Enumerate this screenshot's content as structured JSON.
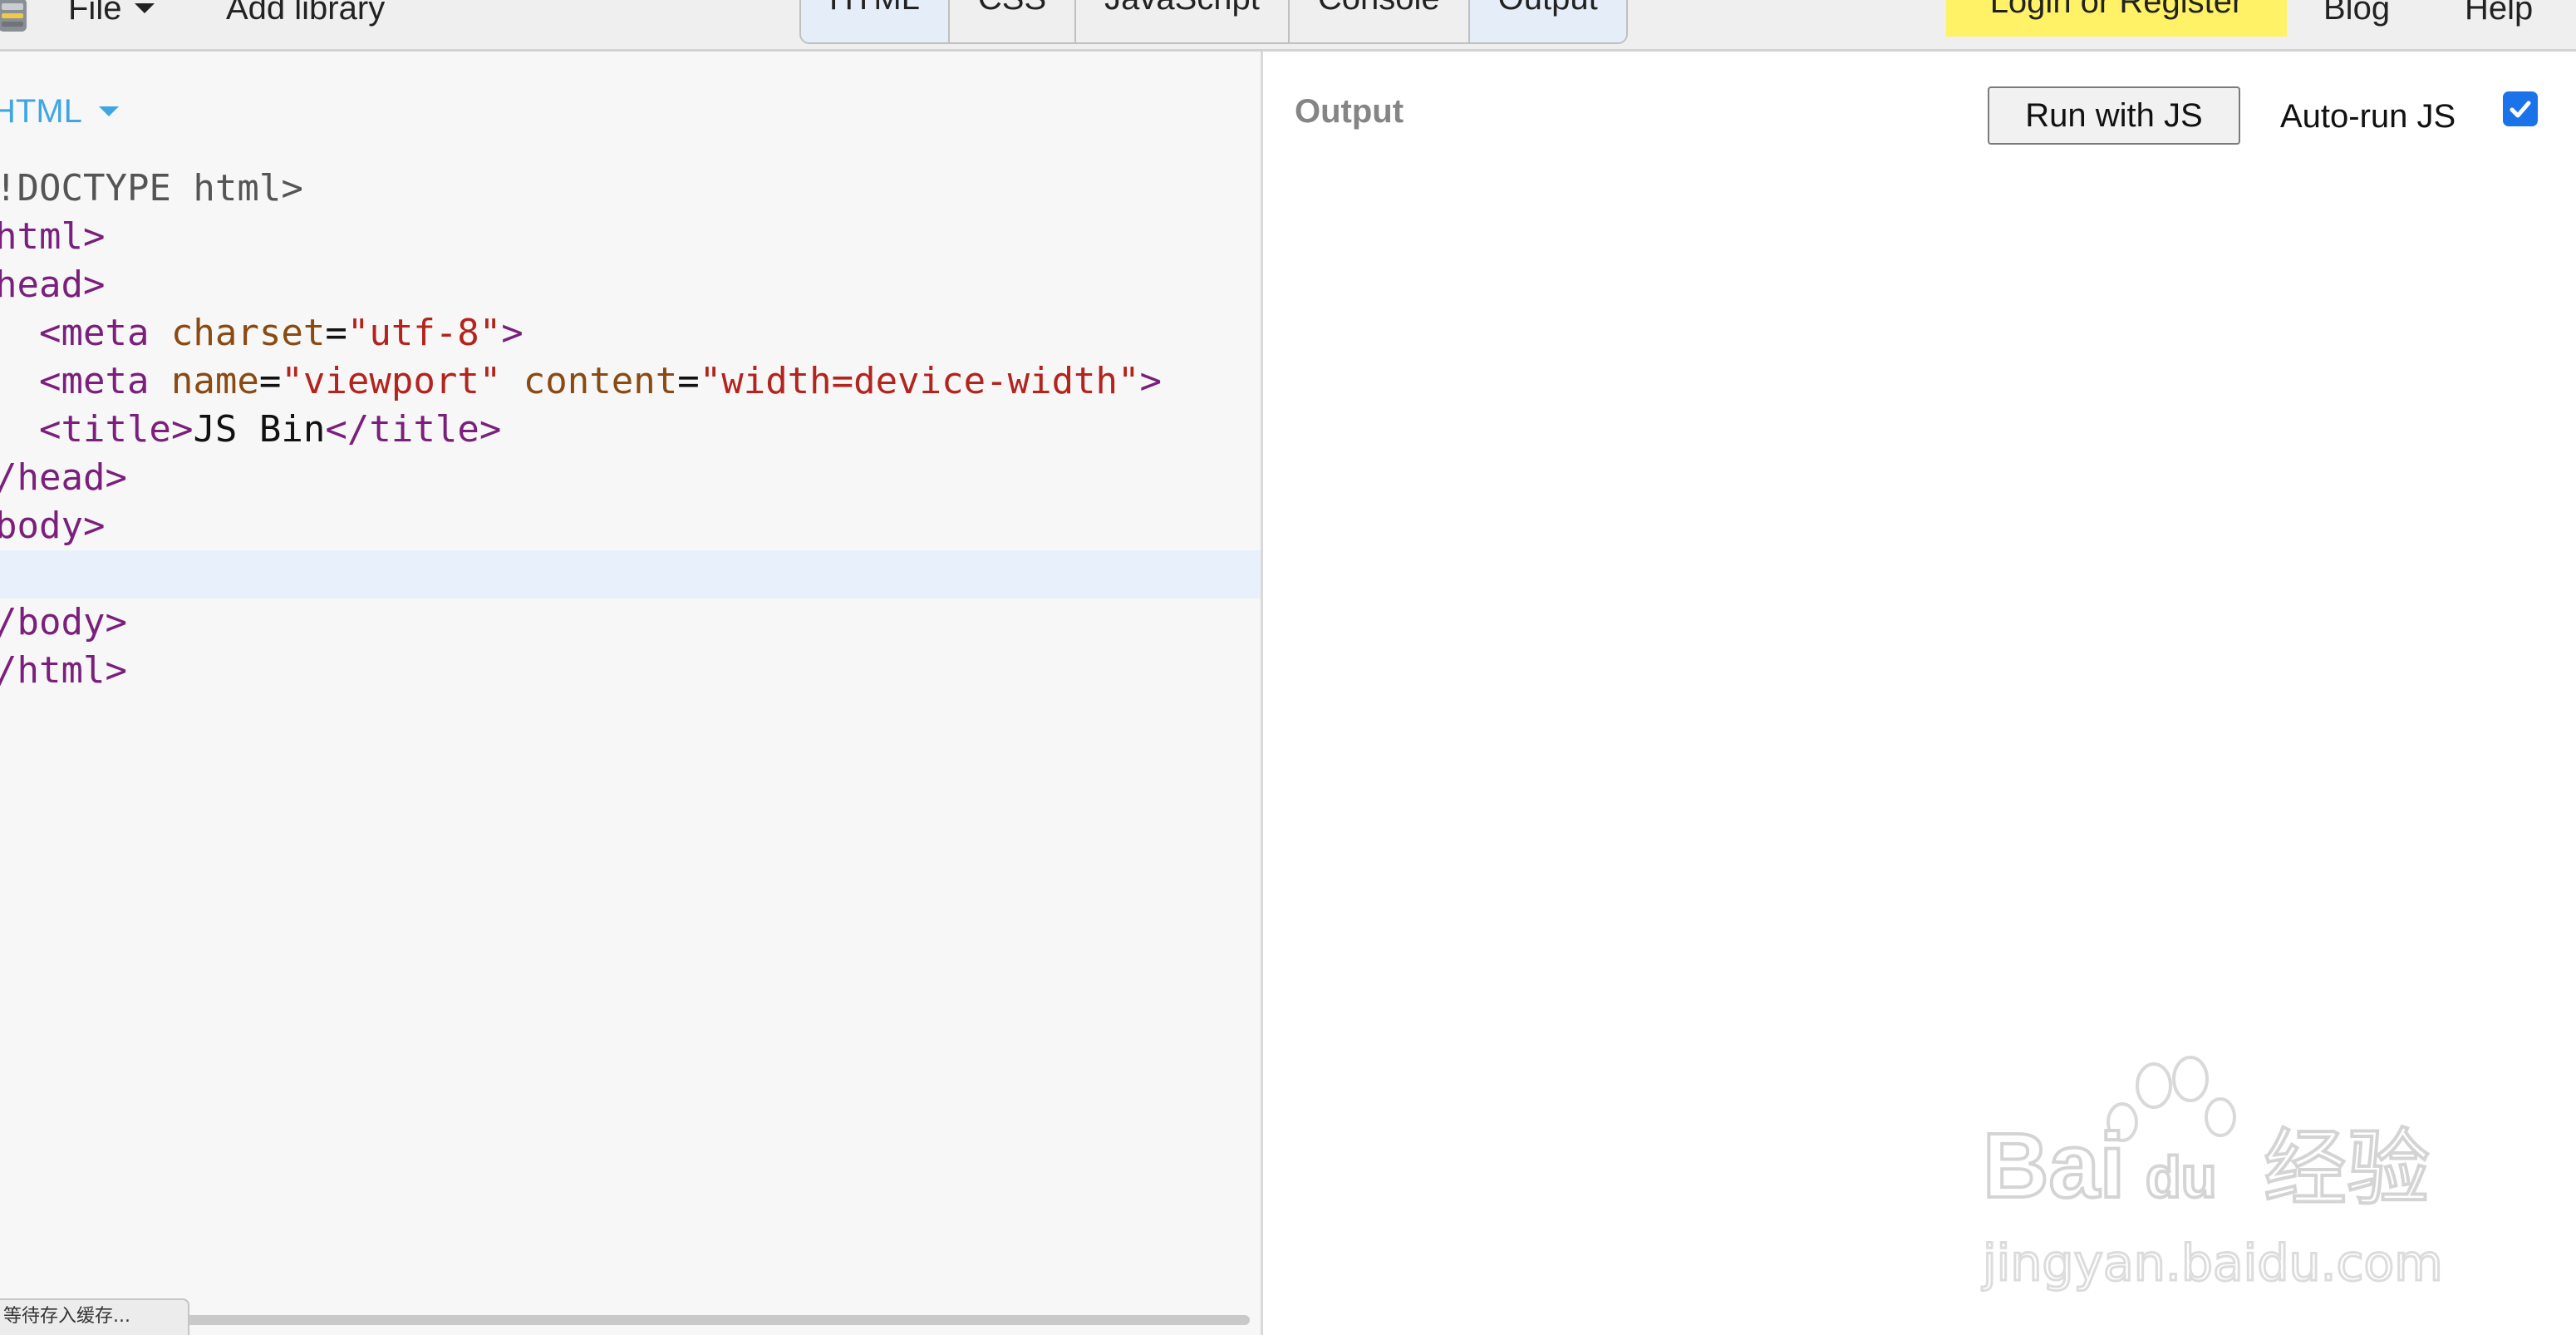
{
  "toolbar": {
    "file_label": "File",
    "add_library_label": "Add library",
    "panel_tabs": [
      {
        "label": "HTML",
        "active": true
      },
      {
        "label": "CSS",
        "active": false
      },
      {
        "label": "JavaScript",
        "active": false
      },
      {
        "label": "Console",
        "active": false
      },
      {
        "label": "Output",
        "active": true
      }
    ],
    "login_label": "Login or Register",
    "blog_label": "Blog",
    "help_label": "Help"
  },
  "editor": {
    "panel_label": "HTML",
    "code_lines": [
      "!DOCTYPE html>",
      "html>",
      "head>",
      "  <meta charset=\"utf-8\">",
      "  <meta name=\"viewport\" content=\"width=device-width\">",
      "  <title>JS Bin</title>",
      "/head>",
      "body>",
      "",
      "/body>",
      "/html>"
    ],
    "active_line": 9,
    "status_text": "等待存入缓存..."
  },
  "output": {
    "panel_label": "Output",
    "run_button_label": "Run with JS",
    "autorun_label": "Auto-run JS",
    "autorun_checked": true
  },
  "watermark": {
    "brand_left": "Bai",
    "brand_paw": "du",
    "brand_right": "经验",
    "url": "jingyan.baidu.com"
  },
  "colors": {
    "tab_active_bg": "#e5edf9",
    "login_bg": "#fff266",
    "editor_label": "#3ea7e3",
    "tag": "#7a1f7c",
    "attribute": "#8a4a12",
    "string": "#b3241e",
    "checkbox": "#1a73e8"
  }
}
